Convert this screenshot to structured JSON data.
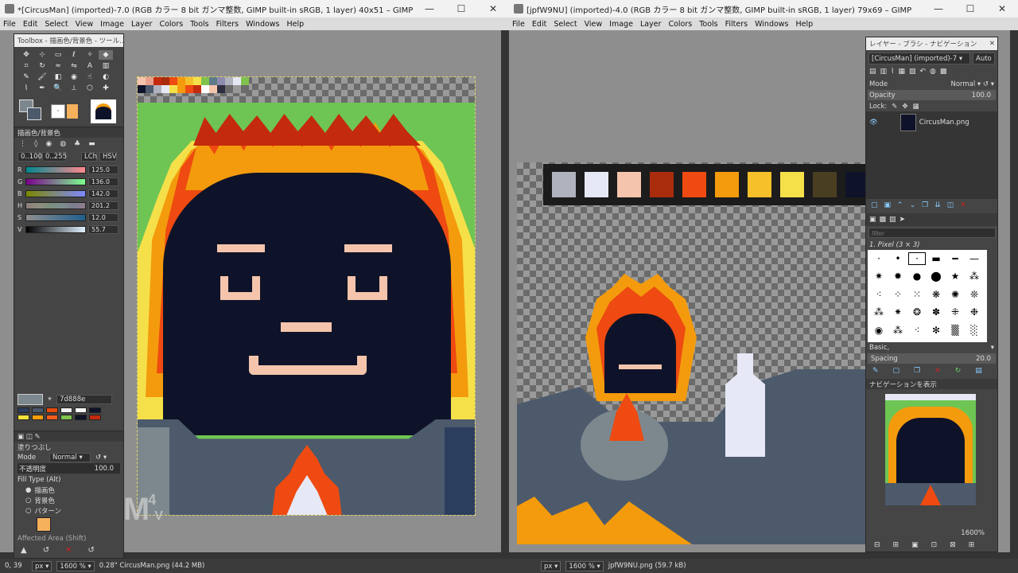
{
  "left_window": {
    "title": "*[CircusMan] (imported)-7.0 (RGB カラー 8 bit ガンマ整数, GIMP built-in sRGB, 1 layer) 40x51 – GIMP",
    "menu": [
      "File",
      "Edit",
      "Select",
      "View",
      "Image",
      "Layer",
      "Colors",
      "Tools",
      "Filters",
      "Windows",
      "Help"
    ],
    "status": {
      "coords": "0, 39",
      "unit": "px",
      "zoom": "1600 %",
      "info": "0.28\" CircusMan.png (44.2 MB)"
    }
  },
  "right_window": {
    "title": "[jpfW9NU] (imported)-4.0 (RGB カラー 8 bit ガンマ整数, GIMP built-in sRGB, 1 layer) 79x69 – GIMP",
    "menu": [
      "File",
      "Edit",
      "Select",
      "View",
      "Image",
      "Layer",
      "Colors",
      "Tools",
      "Filters",
      "Windows",
      "Help"
    ],
    "status": {
      "unit": "px",
      "zoom": "1600 %",
      "info": "jpfW9NU.png (59.7 kB)"
    }
  },
  "toolbox": {
    "title": "Toolbox - 描画色/背景色 - ツール...",
    "fgbg_title": "描画色/背景色",
    "range_a": "0..100",
    "range_b": "0..255",
    "mode_a": "LCh",
    "mode_b": "HSV",
    "sliders": [
      {
        "label": "R",
        "value": "125.0"
      },
      {
        "label": "G",
        "value": "136.0"
      },
      {
        "label": "B",
        "value": "142.0"
      },
      {
        "label": "H",
        "value": "201.2"
      },
      {
        "label": "S",
        "value": "12.0"
      },
      {
        "label": "V",
        "value": "55.7"
      }
    ],
    "hex": "7d888e",
    "history_colors": [
      "#2c3e5e",
      "#4c5a6c",
      "#e64a0c",
      "#f0f0f0",
      "#ffffff",
      "#f5e23a",
      "#ff9f0a",
      "#f15b1c",
      "#7fc34d",
      "#0f1329",
      "#c42a0e"
    ],
    "fill_title": "塗りつぶし",
    "mode_label": "Mode",
    "mode_value": "Normal",
    "opacity_label": "不透明度",
    "opacity_value": "100.0",
    "fill_type_label": "Fill Type  (Alt)",
    "fill_options": [
      "描画色",
      "背景色",
      "パターン"
    ],
    "affected": "Affected Area  (Shift)"
  },
  "dock": {
    "title": "レイヤー - ブラシ - ナビゲーション",
    "image_select": "[CircusMan] (imported)-7",
    "auto": "Auto",
    "mode_label": "Mode",
    "mode_value": "Normal",
    "opacity_label": "Opacity",
    "opacity_value": "100.0",
    "lock_label": "Lock:",
    "layer_name": "CircusMan.png",
    "filter_placeholder": "filter",
    "brush_name": "1. Pixel (3 × 3)",
    "brush_set": "Basic,",
    "spacing_label": "Spacing",
    "spacing_value": "20.0",
    "nav_title": "ナビゲーションを表示",
    "nav_zoom": "1600%"
  },
  "palette_right": [
    "#b0b2bd",
    "#e6e8f5",
    "#f4c5ac",
    "#a92c0d",
    "#ee4a11",
    "#f39b0d",
    "#f5c02a",
    "#f5e04a",
    "#4a3e22",
    "#0f1329"
  ],
  "watermark": {
    "text": "AM",
    "sup": "4",
    "sub": "V"
  }
}
